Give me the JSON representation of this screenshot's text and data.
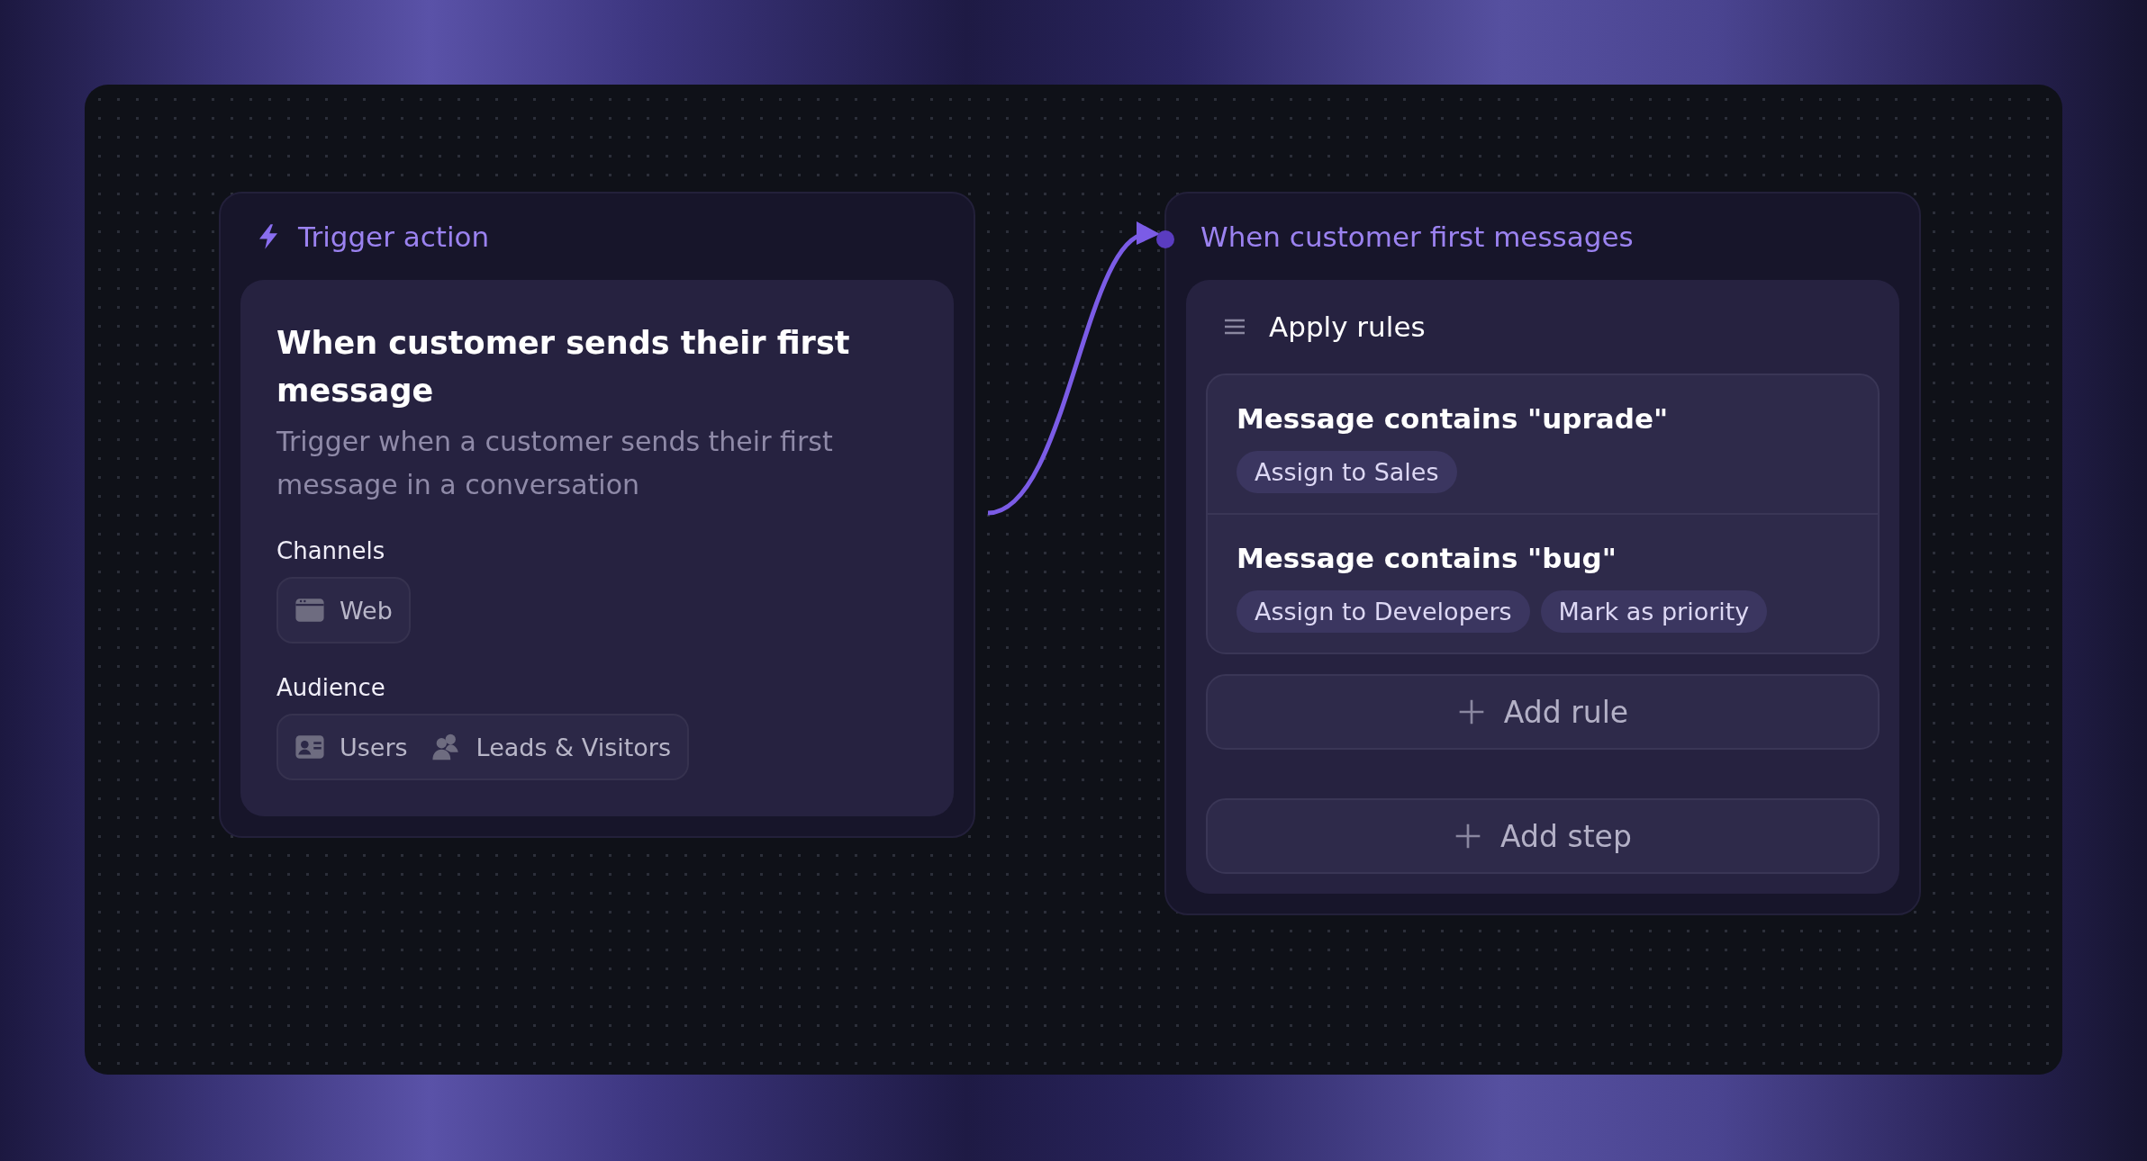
{
  "nodes": [
    {
      "kind": "trigger",
      "header": "Trigger action",
      "title": "When customer sends their first message",
      "description": "Trigger when a customer sends their first message in a conversation",
      "sections": [
        {
          "label": "Channels",
          "chips": [
            "Web"
          ]
        },
        {
          "label": "Audience",
          "chips": [
            "Users",
            "Leads & Visitors"
          ]
        }
      ]
    },
    {
      "kind": "rules",
      "header": "When customer first messages",
      "title": "Apply rules",
      "rules": [
        {
          "title": "Message contains \"uprade\"",
          "tags": [
            "Assign to Sales"
          ]
        },
        {
          "title": "Message contains \"bug\"",
          "tags": [
            "Assign to Developers",
            "Mark as priority"
          ]
        }
      ],
      "add_rule": "Add rule",
      "add_step": "Add step"
    }
  ]
}
